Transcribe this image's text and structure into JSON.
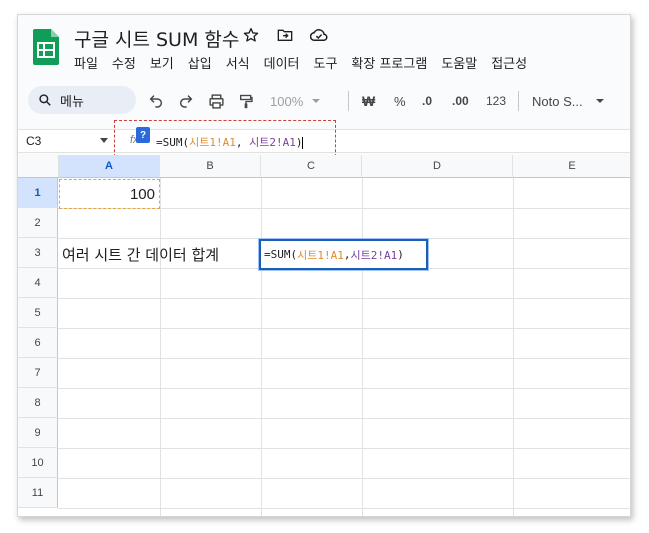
{
  "app": {
    "title": "구글 시트 SUM 함수",
    "title_icons": [
      "star-icon",
      "move-folder-icon",
      "cloud-saved-icon"
    ]
  },
  "menu": [
    "파일",
    "수정",
    "보기",
    "삽입",
    "서식",
    "데이터",
    "도구",
    "확장 프로그램",
    "도움말",
    "접근성"
  ],
  "toolbar": {
    "search_label": "메뉴",
    "zoom": "100%",
    "currency": "₩",
    "percent": "%",
    "decimal_decrease": ".0",
    "decimal_increase": ".00",
    "number_format": "123",
    "font": "Noto S..."
  },
  "formula_bar": {
    "name_box": "C3",
    "fx_label": "fx",
    "help_label": "?",
    "formula_prefix": "=SUM(",
    "ref1": "시트1!A1",
    "separator": ", ",
    "ref2": "시트2!A1",
    "formula_suffix": ")"
  },
  "grid": {
    "columns": [
      "A",
      "B",
      "C",
      "D",
      "E"
    ],
    "selected_column": "A",
    "rows": [
      "1",
      "2",
      "3",
      "4",
      "5",
      "6",
      "7",
      "8",
      "9",
      "10",
      "11"
    ],
    "selected_row": "1",
    "cells": {
      "A1": "100",
      "A3": "여러 시트 간 데이터 합계",
      "C3_prefix": "=SUM(",
      "C3_ref1": "시트1!A1",
      "C3_sep": ", ",
      "C3_ref2": "시트2!A1",
      "C3_suffix": ")"
    }
  },
  "colors": {
    "accent": "#0b57d0",
    "ref1_color": "#e08b2e",
    "ref2_color": "#7b3fa0",
    "annotation_box": "#d0403a",
    "logo_green": "#0f9d58"
  }
}
